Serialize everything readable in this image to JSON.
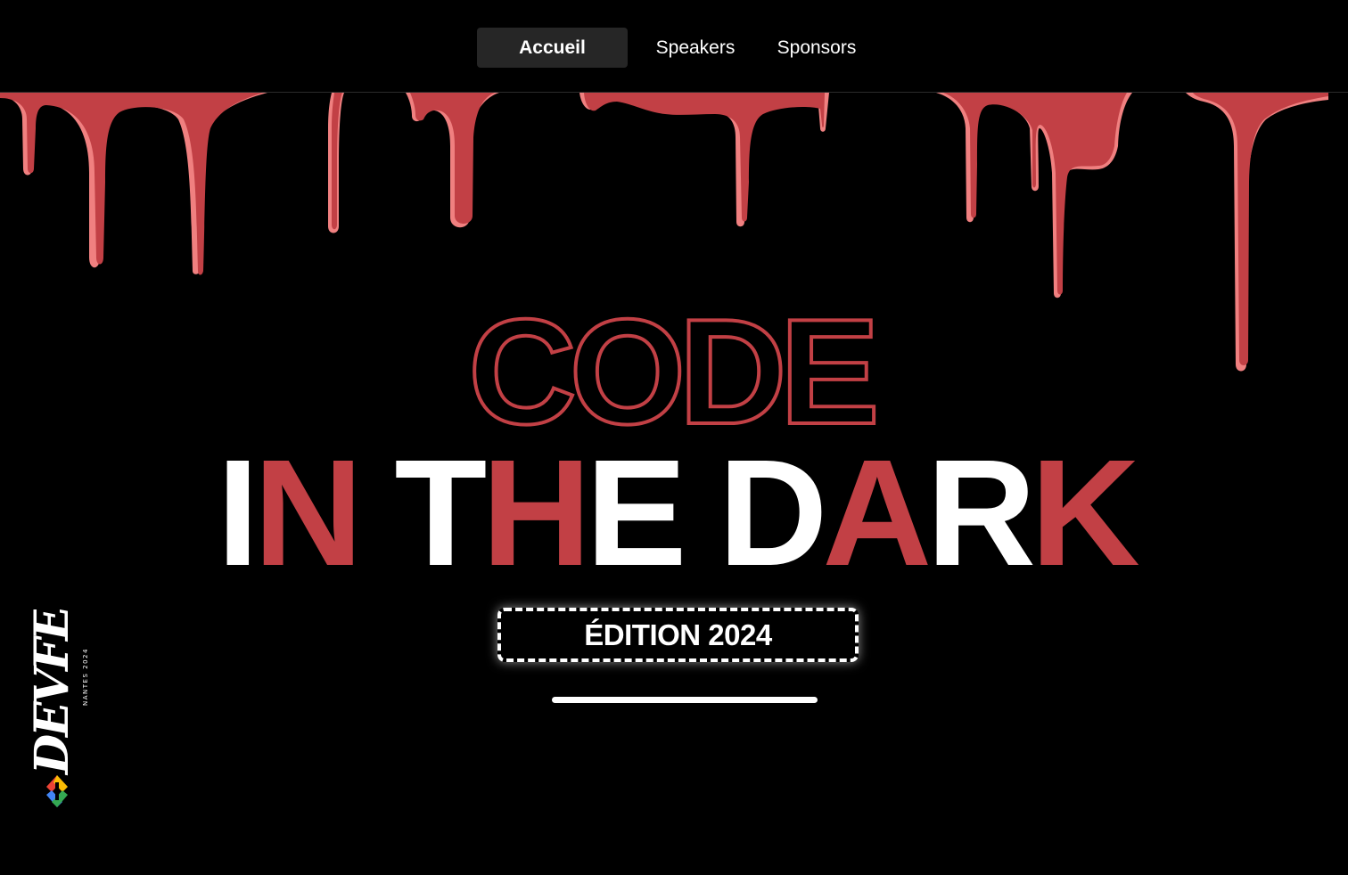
{
  "nav": {
    "items": [
      {
        "label": "Accueil",
        "active": true
      },
      {
        "label": "Speakers",
        "active": false
      },
      {
        "label": "Sponsors",
        "active": false
      }
    ]
  },
  "hero": {
    "title_line1": "CODE",
    "title_line2": "IN THE DARK",
    "edition_label": "ÉDITION 2024"
  },
  "logo": {
    "wordmark": "DEVFEST",
    "subtitle": "NANTES 2024"
  },
  "colors": {
    "background": "#000000",
    "blood_red": "#c24045",
    "blood_highlight": "#f08080",
    "text_white": "#ffffff",
    "nav_active_bg": "#262626"
  }
}
